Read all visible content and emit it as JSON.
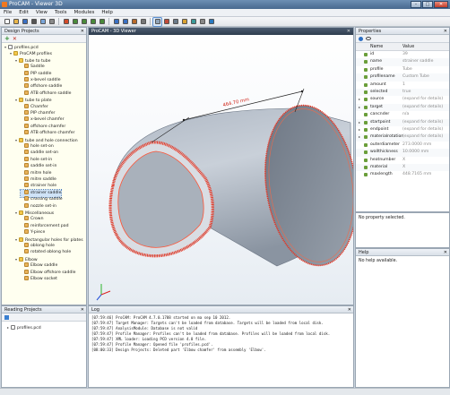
{
  "window": {
    "title": "ProCAM - Viewer 3D",
    "buttons": [
      "–",
      "□",
      "✕"
    ]
  },
  "menu": [
    "File",
    "Edit",
    "View",
    "Tools",
    "Modules",
    "Help"
  ],
  "toolbar_icons": [
    "new-icon",
    "open-icon",
    "save-icon",
    "print-icon",
    "copy-icon",
    "settings-icon",
    "model-icon",
    "view-front-icon",
    "view-top-icon",
    "view-side-icon",
    "view-iso-icon",
    "zoom-fit-icon",
    "zoom-in-icon",
    "rotate-icon",
    "pan-icon",
    "shaded-icon",
    "wireframe-icon",
    "hidden-lines-icon",
    "measure-icon",
    "section-icon",
    "grid-icon",
    "export-icon"
  ],
  "design_projects": {
    "title": "Design Projects",
    "add_label": "+",
    "remove_label": "✕",
    "items": [
      {
        "label": "profiles.pcd",
        "type": "file",
        "depth": 0
      },
      {
        "label": "ProCAM profiles",
        "type": "folder",
        "depth": 1
      },
      {
        "label": "tube to tube",
        "type": "folder",
        "depth": 2
      },
      {
        "label": "Saddle",
        "type": "part",
        "depth": 3
      },
      {
        "label": "PIP saddle",
        "type": "part",
        "depth": 3
      },
      {
        "label": "x-bevel saddle",
        "type": "part",
        "depth": 3
      },
      {
        "label": "offshore saddle",
        "type": "part",
        "depth": 3
      },
      {
        "label": "ATB offshore saddle",
        "type": "part",
        "depth": 3
      },
      {
        "label": "tube to plate",
        "type": "folder",
        "depth": 2
      },
      {
        "label": "Chamfer",
        "type": "part",
        "depth": 3
      },
      {
        "label": "PIP chamfer",
        "type": "part",
        "depth": 3
      },
      {
        "label": "x-bevel chamfer",
        "type": "part",
        "depth": 3
      },
      {
        "label": "offshore chamfer",
        "type": "part",
        "depth": 3
      },
      {
        "label": "ATB offshore chamfer",
        "type": "part",
        "depth": 3
      },
      {
        "label": "tube and hole connection",
        "type": "folder",
        "depth": 2
      },
      {
        "label": "hole set-on",
        "type": "part",
        "depth": 3
      },
      {
        "label": "saddle set-on",
        "type": "part",
        "depth": 3
      },
      {
        "label": "hole set-in",
        "type": "part",
        "depth": 3
      },
      {
        "label": "saddle set-in",
        "type": "part",
        "depth": 3
      },
      {
        "label": "mitre hole",
        "type": "part",
        "depth": 3
      },
      {
        "label": "mitre saddle",
        "type": "part",
        "depth": 3
      },
      {
        "label": "strainer hole",
        "type": "part",
        "depth": 3
      },
      {
        "label": "strainer saddle",
        "type": "part",
        "depth": 3,
        "selected": true
      },
      {
        "label": "crossing saddle",
        "type": "part",
        "depth": 3
      },
      {
        "label": "nozzle set-in",
        "type": "part",
        "depth": 3
      },
      {
        "label": "Miscellaneous",
        "type": "folder",
        "depth": 2
      },
      {
        "label": "Crown",
        "type": "part",
        "depth": 3
      },
      {
        "label": "reinforcement pad",
        "type": "part",
        "depth": 3
      },
      {
        "label": "Y-piece",
        "type": "part",
        "depth": 3
      },
      {
        "label": "Rectangular holes for plates",
        "type": "folder",
        "depth": 2
      },
      {
        "label": "oblong hole",
        "type": "part",
        "depth": 3
      },
      {
        "label": "rotated oblong hole",
        "type": "part",
        "depth": 3
      },
      {
        "label": "Elbow",
        "type": "folder",
        "depth": 2
      },
      {
        "label": "Elbow saddle",
        "type": "part",
        "depth": 3
      },
      {
        "label": "Elbow offshore saddle",
        "type": "part",
        "depth": 3
      },
      {
        "label": "Elbow socket",
        "type": "part",
        "depth": 3
      }
    ]
  },
  "reading_projects": {
    "title": "Reading Projects",
    "items": [
      {
        "label": "profiles.pcd"
      }
    ]
  },
  "viewer": {
    "title": "ProCAM - 3D Viewer",
    "dimension_label": "464.70 mm"
  },
  "properties": {
    "title": "Properties",
    "col_name": "Name",
    "col_value": "Value",
    "rows": [
      {
        "name": "id",
        "value": "39"
      },
      {
        "name": "name",
        "value": "strainer saddle"
      },
      {
        "name": "profile",
        "value": "Tube"
      },
      {
        "name": "profilename",
        "value": "Custom Tube"
      },
      {
        "name": "amount",
        "value": "1"
      },
      {
        "name": "selected",
        "value": "true"
      },
      {
        "name": "source",
        "value": "(expand for details)",
        "expandable": true
      },
      {
        "name": "target",
        "value": "(expand for details)",
        "expandable": true
      },
      {
        "name": "cancnder",
        "value": "n/a"
      },
      {
        "name": "startpoint",
        "value": "(expand for details)",
        "expandable": true
      },
      {
        "name": "endpoint",
        "value": "(expand for details)",
        "expandable": true
      },
      {
        "name": "materialrotation",
        "value": "(expand for details)",
        "expandable": true
      },
      {
        "name": "outerdiameter",
        "value": "273.0000 mm"
      },
      {
        "name": "wallthickness",
        "value": "10.0000 mm"
      },
      {
        "name": "heatnumber",
        "value": "X"
      },
      {
        "name": "material",
        "value": "X"
      },
      {
        "name": "maxlength",
        "value": "448.7165 mm"
      }
    ]
  },
  "no_property": {
    "text": "No property selected."
  },
  "help": {
    "title": "Help",
    "text": "No help available."
  },
  "log": {
    "title": "Log",
    "lines": [
      "[07:59:46] ProCAM: ProCAM 4.7.0.1788 started on ma sep 10 2012.",
      "[07:59:47] Target Manager: Targets can't be loaded from database. Targets will be loaded from local disk.",
      "[07:59:47] AnalysisModule: Database is not valid",
      "[07:59:47] Profile Manager: Profiles can't be loaded from database. Profiles will be loaded from local disk.",
      "[07:59:47] XML loader: Loading PCD version 4.0 file.",
      "[07:59:47] Profile Manager: Opened file 'profiles.pcd'.",
      "[08:00:33] Design Projects: Deleted part 'Elbow chamfer' from assembly 'Elbow'."
    ]
  },
  "colors": {
    "accent": "#e8321e",
    "selection": "#cfe3f7",
    "tree_bg": "#fffff0",
    "viewer_head": "#2f3d4f"
  }
}
